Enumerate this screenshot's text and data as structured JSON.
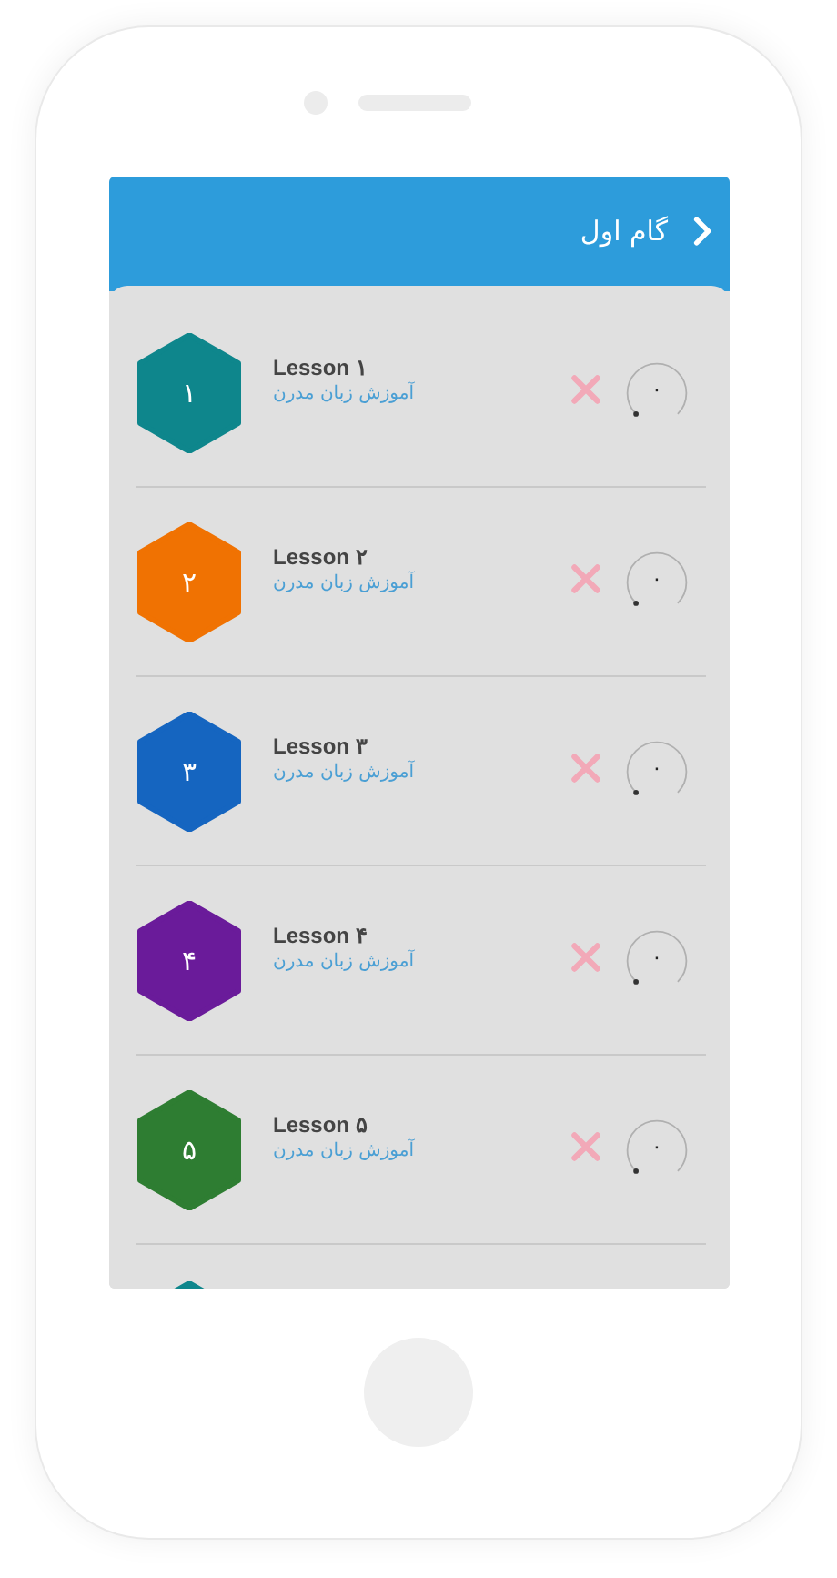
{
  "header": {
    "title": "گام اول"
  },
  "lessons": [
    {
      "kind": "lesson",
      "number": "۱",
      "title": "Lesson ۱",
      "subtitle": "آموزش زبان مدرن",
      "color": "#0e868c",
      "progress": "۰"
    },
    {
      "kind": "lesson",
      "number": "۲",
      "title": "Lesson ۲",
      "subtitle": "آموزش زبان مدرن",
      "color": "#f07202",
      "progress": "۰"
    },
    {
      "kind": "lesson",
      "number": "۳",
      "title": "Lesson ۳",
      "subtitle": "آموزش زبان مدرن",
      "color": "#1565c0",
      "progress": "۰"
    },
    {
      "kind": "lesson",
      "number": "۴",
      "title": "Lesson ۴",
      "subtitle": "آموزش زبان مدرن",
      "color": "#6a1b9a",
      "progress": "۰"
    },
    {
      "kind": "lesson",
      "number": "۵",
      "title": "Lesson ۵",
      "subtitle": "آموزش زبان مدرن",
      "color": "#2e7d32",
      "progress": "۰"
    },
    {
      "kind": "peek",
      "color": "#0e868c"
    }
  ]
}
